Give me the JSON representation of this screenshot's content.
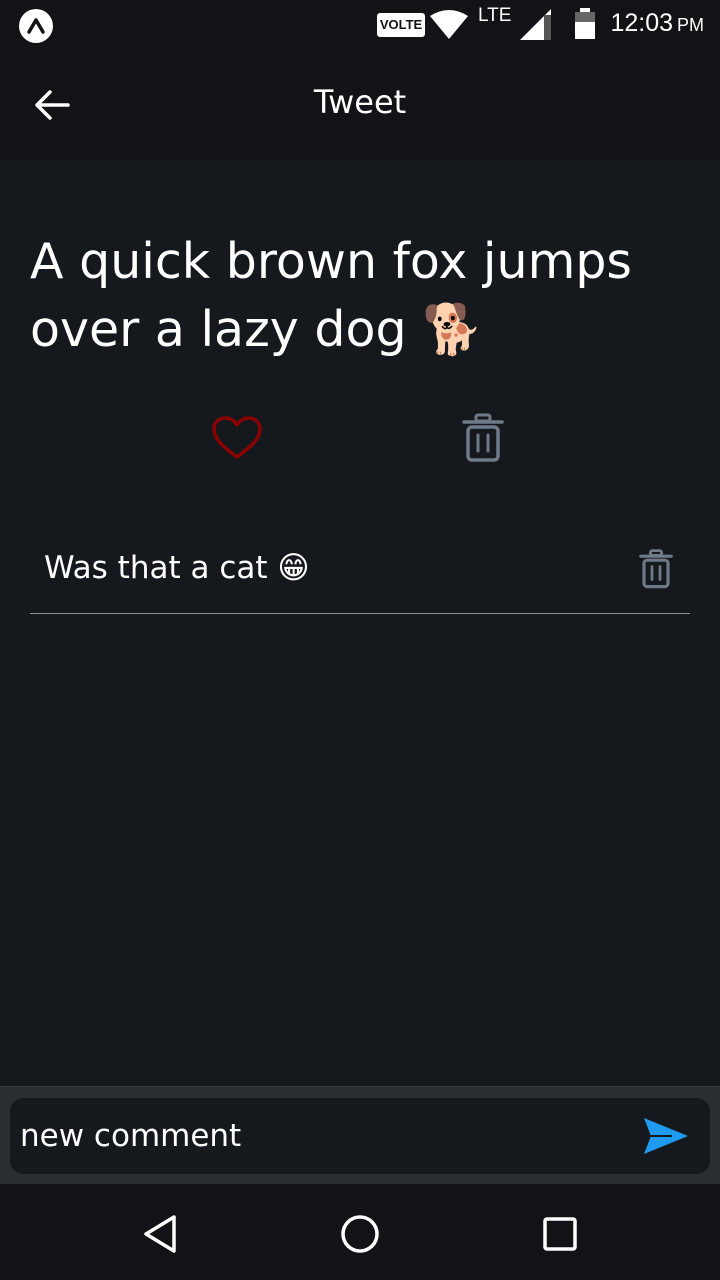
{
  "status_bar": {
    "network_badge": "VOLTE",
    "network_type": "LTE",
    "time": "12:03",
    "ampm": "PM"
  },
  "header": {
    "title": "Tweet",
    "back_icon": "arrow-left-icon"
  },
  "tweet": {
    "text": "A quick brown fox jumps over a lazy dog 🐕",
    "like_icon": "heart-outline-icon",
    "delete_icon": "trash-icon"
  },
  "comments": [
    {
      "text": "Was that a cat 😁",
      "delete_icon": "trash-icon"
    }
  ],
  "comment_input": {
    "placeholder": "new comment",
    "send_icon": "send-icon"
  },
  "colors": {
    "background": "#15181c",
    "like_color": "#8b0000",
    "icon_gray": "#6e7a88",
    "send_blue": "#1e9bf0"
  }
}
